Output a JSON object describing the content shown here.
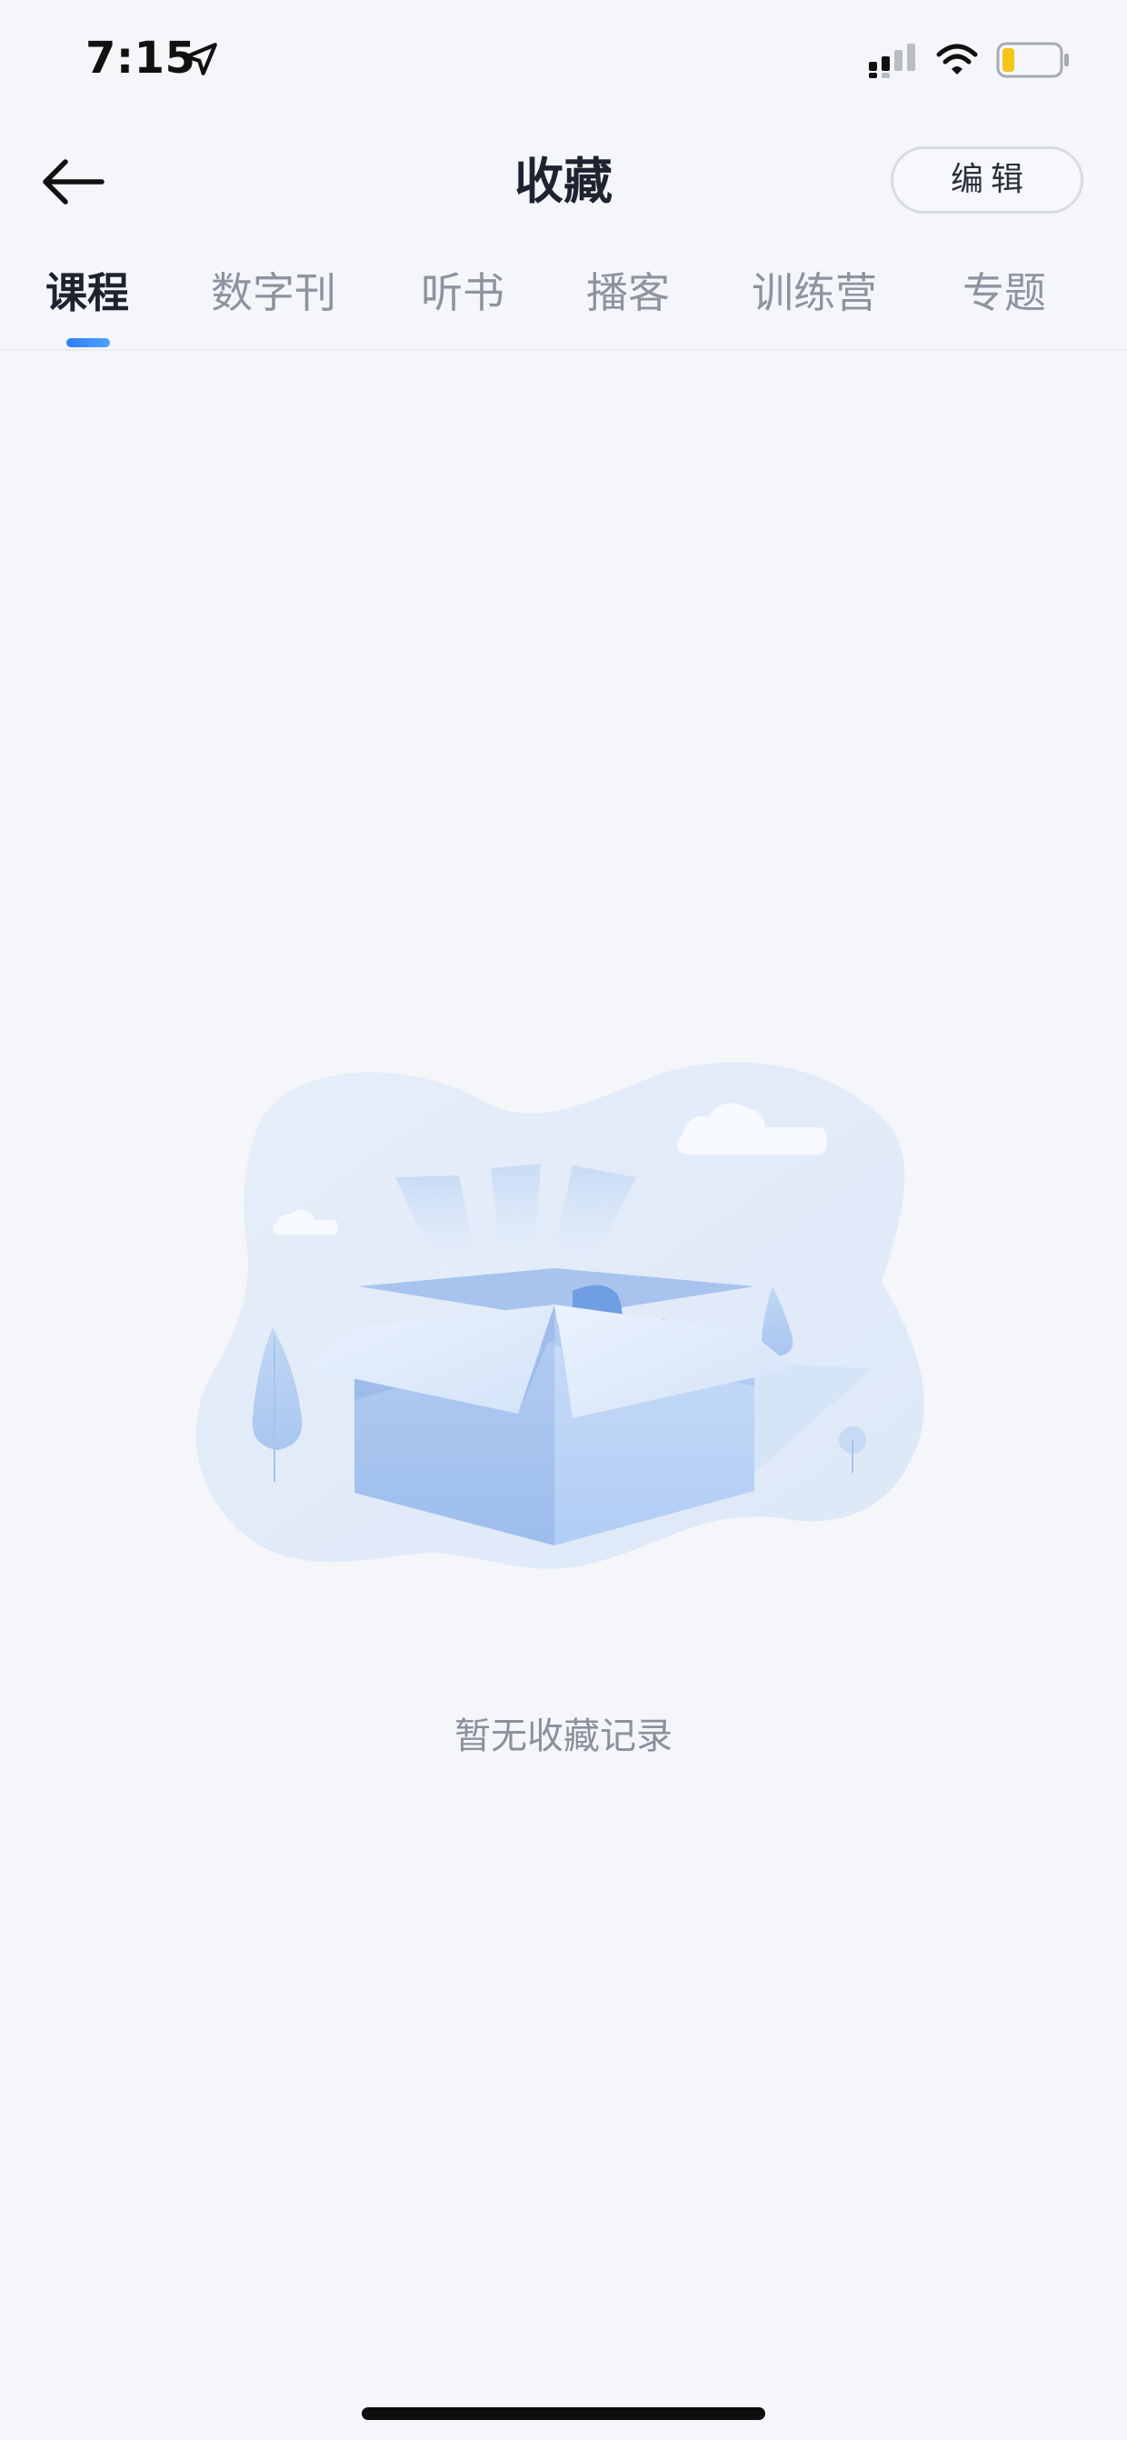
{
  "status_bar": {
    "time": "7:15",
    "icons": [
      "location-arrow-icon",
      "cellular-signal-icon",
      "wifi-icon",
      "battery-low-icon"
    ],
    "battery_color": "#f5c518"
  },
  "nav": {
    "back_icon": "arrow-left-icon",
    "title": "收藏",
    "edit_label": "编辑"
  },
  "tabs": [
    {
      "label": "课程",
      "active": true
    },
    {
      "label": "数字刊",
      "active": false
    },
    {
      "label": "听书",
      "active": false
    },
    {
      "label": "播客",
      "active": false
    },
    {
      "label": "训练营",
      "active": false
    },
    {
      "label": "专题",
      "active": false
    }
  ],
  "empty_state": {
    "illustration": "open-box-illustration",
    "message": "暂无收藏记录"
  },
  "colors": {
    "accent": "#2f7df6",
    "background": "#f5f6fa",
    "title_text": "#1e2330",
    "muted_text": "#8e939f"
  }
}
